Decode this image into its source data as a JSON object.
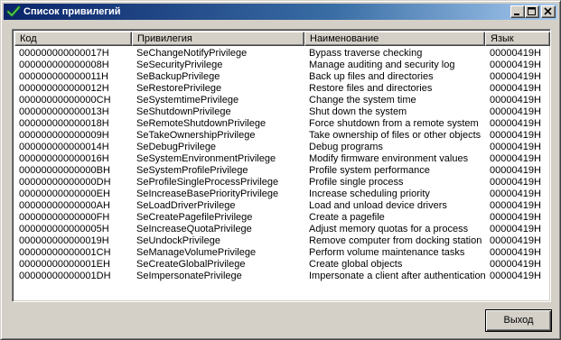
{
  "window": {
    "title": "Список привилегий"
  },
  "columns": [
    "Код",
    "Привилегия",
    "Наименование",
    "Язык"
  ],
  "rows": [
    [
      "000000000000017H",
      "SeChangeNotifyPrivilege",
      "Bypass traverse checking",
      "00000419H"
    ],
    [
      "000000000000008H",
      "SeSecurityPrivilege",
      "Manage auditing and security log",
      "00000419H"
    ],
    [
      "000000000000011H",
      "SeBackupPrivilege",
      "Back up files and directories",
      "00000419H"
    ],
    [
      "000000000000012H",
      "SeRestorePrivilege",
      "Restore files and directories",
      "00000419H"
    ],
    [
      "00000000000000CH",
      "SeSystemtimePrivilege",
      "Change the system time",
      "00000419H"
    ],
    [
      "000000000000013H",
      "SeShutdownPrivilege",
      "Shut down the system",
      "00000419H"
    ],
    [
      "000000000000018H",
      "SeRemoteShutdownPrivilege",
      "Force shutdown from a remote system",
      "00000419H"
    ],
    [
      "000000000000009H",
      "SeTakeOwnershipPrivilege",
      "Take ownership of files or other objects",
      "00000419H"
    ],
    [
      "000000000000014H",
      "SeDebugPrivilege",
      "Debug programs",
      "00000419H"
    ],
    [
      "000000000000016H",
      "SeSystemEnvironmentPrivilege",
      "Modify firmware environment values",
      "00000419H"
    ],
    [
      "00000000000000BH",
      "SeSystemProfilePrivilege",
      "Profile system performance",
      "00000419H"
    ],
    [
      "00000000000000DH",
      "SeProfileSingleProcessPrivilege",
      "Profile single process",
      "00000419H"
    ],
    [
      "00000000000000EH",
      "SeIncreaseBasePriorityPrivilege",
      "Increase scheduling priority",
      "00000419H"
    ],
    [
      "00000000000000AH",
      "SeLoadDriverPrivilege",
      "Load and unload device drivers",
      "00000419H"
    ],
    [
      "00000000000000FH",
      "SeCreatePagefilePrivilege",
      "Create a pagefile",
      "00000419H"
    ],
    [
      "000000000000005H",
      "SeIncreaseQuotaPrivilege",
      "Adjust memory quotas for a process",
      "00000419H"
    ],
    [
      "000000000000019H",
      "SeUndockPrivilege",
      "Remove computer from docking station",
      "00000419H"
    ],
    [
      "00000000000001CH",
      "SeManageVolumePrivilege",
      "Perform volume maintenance tasks",
      "00000419H"
    ],
    [
      "00000000000001EH",
      "SeCreateGlobalPrivilege",
      "Create global objects",
      "00000419H"
    ],
    [
      "00000000000001DH",
      "SeImpersonatePrivilege",
      "Impersonate a client after authentication",
      "00000419H"
    ]
  ],
  "buttons": {
    "exit_label": "Выход"
  },
  "icons": {
    "title": "checkmark-icon",
    "minimize": "minimize-icon",
    "maximize": "maximize-icon",
    "close": "close-icon"
  },
  "colors": {
    "titlebar_start": "#0a246a",
    "titlebar_end": "#a6caf0",
    "face": "#d4d0c8",
    "list_bg": "#ffffff"
  }
}
